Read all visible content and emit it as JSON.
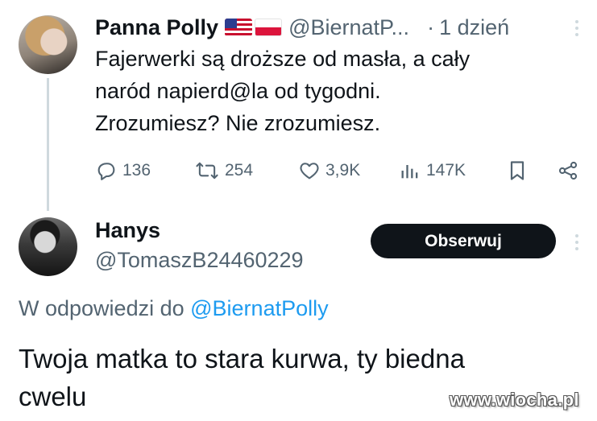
{
  "original_tweet": {
    "display_name": "Panna Polly",
    "flags": [
      "us-flag-icon",
      "pl-flag-icon"
    ],
    "handle": "@BiernatP...",
    "separator": "·",
    "time": "1 dzień",
    "text": "Fajerwerki są droższe od masła, a cały\nnaród napierd@la od tygodni.\nZrozumiesz? Nie zrozumiesz.",
    "actions": {
      "replies": "136",
      "retweets": "254",
      "likes": "3,9K",
      "views": "147K"
    }
  },
  "reply_tweet": {
    "display_name": "Hanys",
    "handle": "@TomaszB24460229",
    "follow_label": "Obserwuj",
    "reply_prefix": "W odpowiedzi do ",
    "reply_mention": "@BiernatPolly",
    "text": "Twoja matka to stara kurwa, ty biedna\ncwelu"
  },
  "watermark": "www.wiocha.pl",
  "colors": {
    "text": "#0f1419",
    "secondary": "#536471",
    "link": "#1d9bf0",
    "button": "#0f1419",
    "thread_line": "#cfd9de"
  }
}
